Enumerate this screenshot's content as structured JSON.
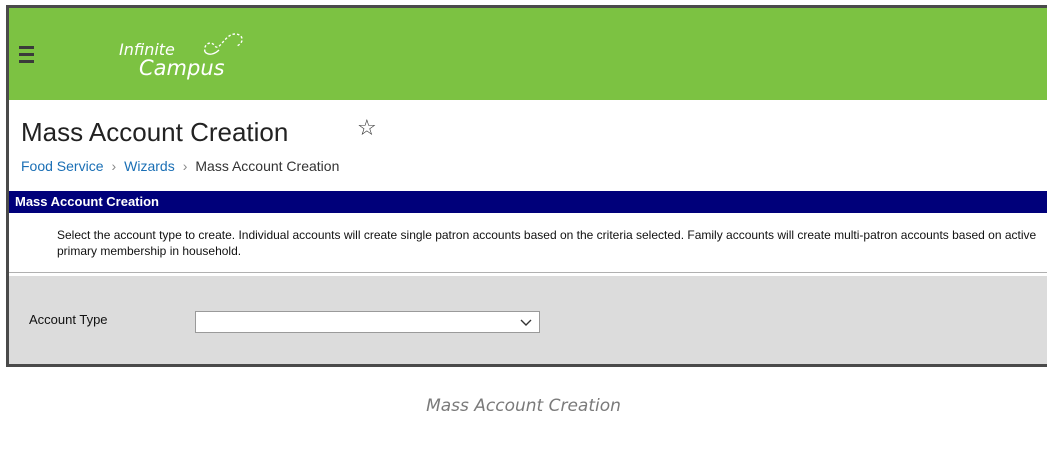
{
  "app": {
    "logo_line1": "Infinite",
    "logo_line2": "Campus",
    "brand_color": "#7cc242"
  },
  "header": {
    "title": "Mass Account Creation",
    "star_icon": "star-outline-icon"
  },
  "breadcrumb": {
    "items": [
      {
        "label": "Food Service",
        "link": true
      },
      {
        "label": "Wizards",
        "link": true
      },
      {
        "label": "Mass Account Creation",
        "link": false
      }
    ],
    "separator": ">"
  },
  "panel": {
    "title": "Mass Account Creation",
    "header_color": "#00007a",
    "description": "Select the account type to create. Individual accounts will create single patron accounts based on the criteria selected. Family accounts will create multi-patron accounts based on active primary membership in household."
  },
  "form": {
    "account_type_label": "Account Type",
    "account_type_value": ""
  },
  "caption": "Mass Account Creation"
}
